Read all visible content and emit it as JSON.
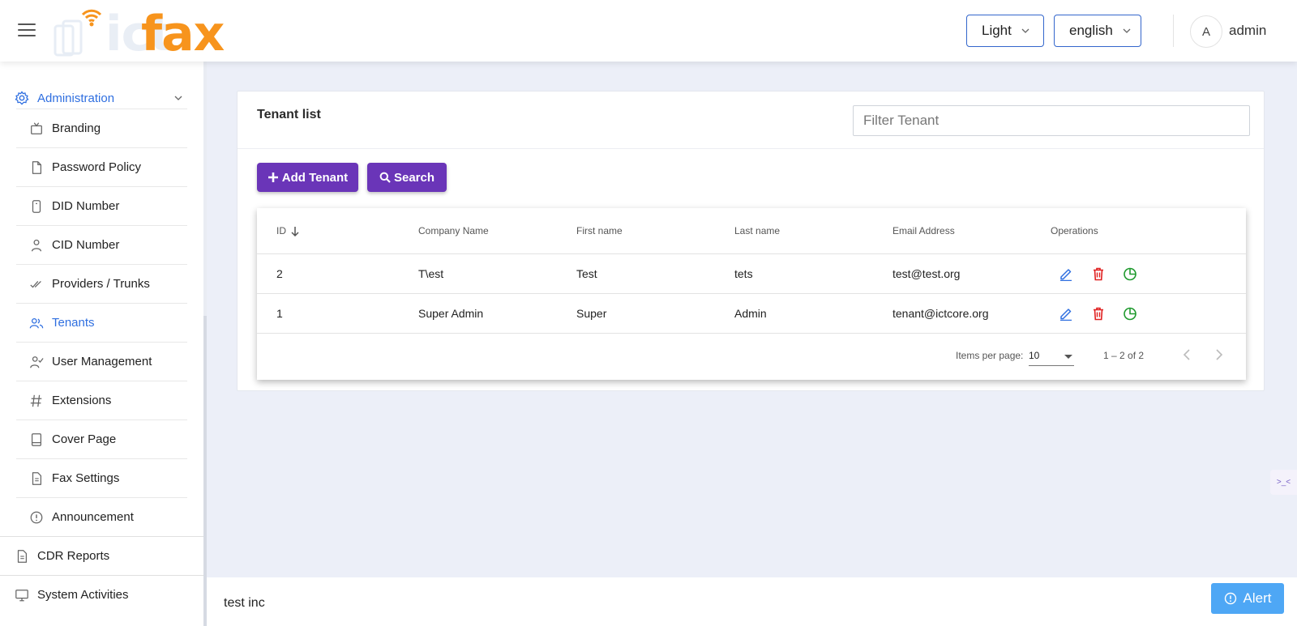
{
  "header": {
    "logo": {
      "prefix": "ict",
      "suffix": "fax"
    },
    "theme_select": "Light",
    "language_select": "english",
    "avatar_initial": "A",
    "user_name": "admin"
  },
  "sidebar": {
    "section": {
      "label": "Administration",
      "icon": "gear-icon"
    },
    "items": [
      {
        "label": "Branding",
        "icon": "tv-icon",
        "active": false
      },
      {
        "label": "Password Policy",
        "icon": "file-icon",
        "active": false
      },
      {
        "label": "DID Number",
        "icon": "phone-icon",
        "active": false
      },
      {
        "label": "CID Number",
        "icon": "person-icon",
        "active": false
      },
      {
        "label": "Providers / Trunks",
        "icon": "double-check-icon",
        "active": false
      },
      {
        "label": "Tenants",
        "icon": "users-icon",
        "active": true
      },
      {
        "label": "User Management",
        "icon": "user-check-icon",
        "active": false
      },
      {
        "label": "Extensions",
        "icon": "hash-icon",
        "active": false
      },
      {
        "label": "Cover Page",
        "icon": "book-icon",
        "active": false
      },
      {
        "label": "Fax Settings",
        "icon": "document-icon",
        "active": false
      },
      {
        "label": "Announcement",
        "icon": "alert-circle-icon",
        "active": false
      }
    ],
    "bottom": [
      {
        "label": "CDR Reports",
        "icon": "report-icon"
      },
      {
        "label": "System Activities",
        "icon": "monitor-icon"
      }
    ]
  },
  "main": {
    "title": "Tenant list",
    "filter_placeholder": "Filter Tenant",
    "buttons": {
      "add": "Add Tenant",
      "search": "Search"
    },
    "table": {
      "columns": [
        "ID",
        "Company Name",
        "First name",
        "Last name",
        "Email Address",
        "Operations"
      ],
      "rows": [
        {
          "id": "2",
          "company": "T\\est",
          "first": "Test",
          "last": "tets",
          "email": "test@test.org"
        },
        {
          "id": "1",
          "company": "Super Admin",
          "first": "Super",
          "last": "Admin",
          "email": "tenant@ictcore.org"
        }
      ]
    },
    "pagination": {
      "items_per_page_label": "Items per page:",
      "items_per_page": "10",
      "range": "1 – 2 of 2"
    }
  },
  "footer": {
    "text": "test inc",
    "alert_label": "Alert"
  },
  "side_widget": ">_<",
  "colors": {
    "accent_blue": "#2f6fe0",
    "button_purple": "#6a35b8",
    "logo_orange": "#f7941d",
    "edit_blue": "#2f6fe0",
    "delete_red": "#e02020",
    "report_green": "#1f9a2e",
    "alert_blue": "#4ea7f5"
  }
}
